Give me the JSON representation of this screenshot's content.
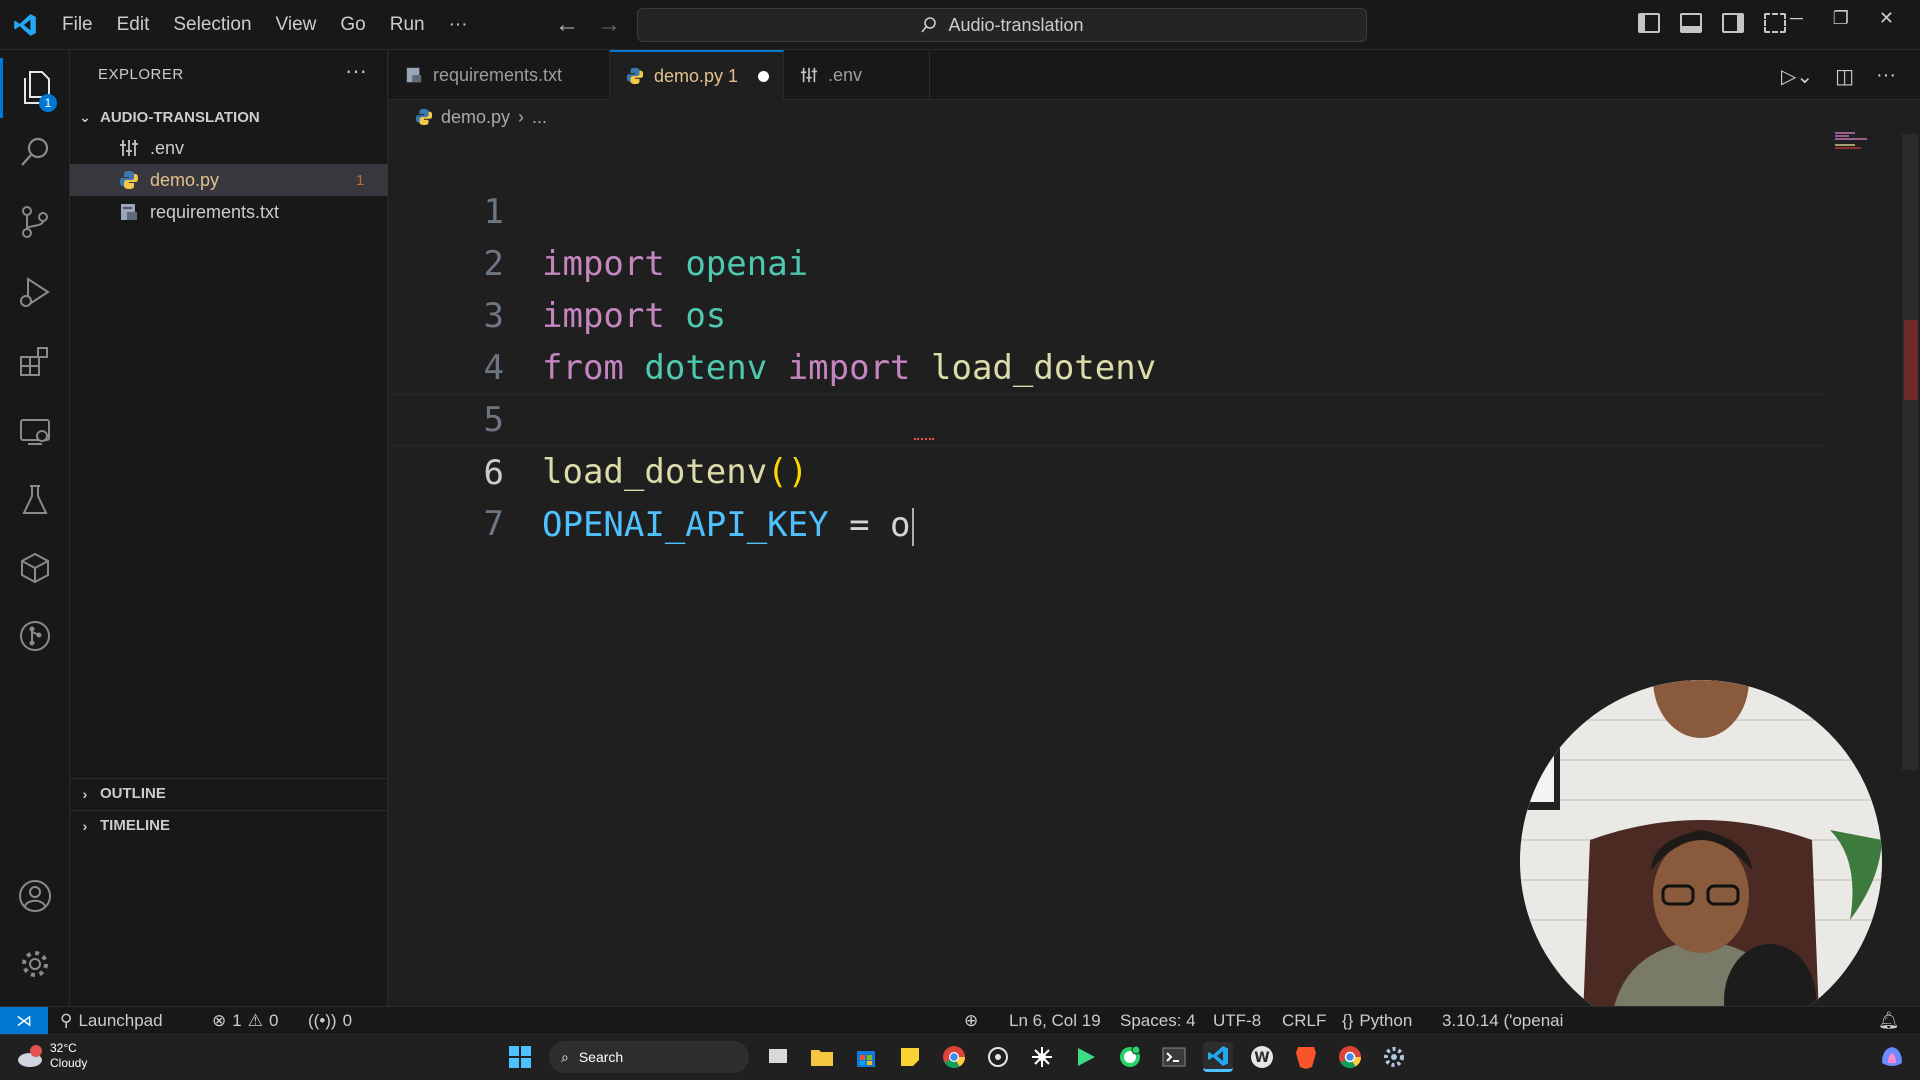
{
  "titlebar": {
    "menu": [
      "File",
      "Edit",
      "Selection",
      "View",
      "Go",
      "Run",
      "···"
    ],
    "command_center": "Audio-translation"
  },
  "activity_bar": {
    "explorer_badge": "1"
  },
  "explorer": {
    "title": "EXPLORER",
    "folder": "AUDIO-TRANSLATION",
    "files": [
      {
        "name": ".env",
        "icon": "settings-file-icon"
      },
      {
        "name": "demo.py",
        "icon": "python-icon",
        "badge": "1",
        "color": "#e2c08d"
      },
      {
        "name": "requirements.txt",
        "icon": "text-file-icon"
      }
    ],
    "outline": "OUTLINE",
    "timeline": "TIMELINE"
  },
  "tabs": [
    {
      "label": "requirements.txt",
      "active": false
    },
    {
      "label": "demo.py 1",
      "active": true,
      "modified": true
    },
    {
      "label": ".env",
      "active": false
    }
  ],
  "breadcrumb": {
    "file": "demo.py",
    "rest": "..."
  },
  "editor": {
    "lines": [
      {
        "num": "1"
      },
      {
        "num": "2"
      },
      {
        "num": "3"
      },
      {
        "num": "4"
      },
      {
        "num": "5"
      },
      {
        "num": "6"
      },
      {
        "num": "7"
      }
    ],
    "code": {
      "l1_kw": "import",
      "l1_mod": "openai",
      "l2_kw": "import",
      "l2_mod": "os",
      "l3_kw1": "from",
      "l3_mod": "dotenv",
      "l3_kw2": "import",
      "l3_fn": "load_dotenv",
      "l5_fn": "load_dotenv",
      "l5_paren": "()",
      "l6_const": "OPENAI_API_KEY",
      "l6_op": "=",
      "l6_val": "o"
    },
    "cursor_line": 6
  },
  "statusbar": {
    "launchpad": "Launchpad",
    "errors": "1",
    "warnings": "0",
    "ports": "0",
    "position": "Ln 6, Col 19",
    "spaces": "Spaces: 4",
    "encoding": "UTF-8",
    "eol": "CRLF",
    "language": "Python",
    "interpreter": "3.10.14 ('openai"
  },
  "taskbar": {
    "temperature": "32°C",
    "weather": "Cloudy",
    "weather_badge": "1",
    "search": "Search"
  },
  "colors": {
    "accent": "#0078d4",
    "keyword": "#c586c0",
    "module": "#4ec9b0",
    "function": "#dcdcaa",
    "constant": "#4fc1ff"
  }
}
